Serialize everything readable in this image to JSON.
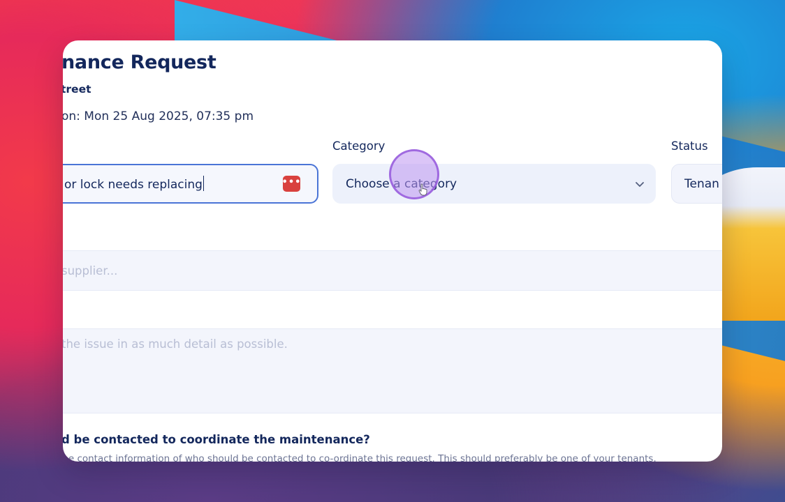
{
  "form": {
    "title": "nance Request",
    "subtitle": "treet",
    "meta": "on: Mon 25 Aug 2025, 07:35 pm"
  },
  "fields": {
    "title_value": "or lock needs replacing",
    "category_label": "Category",
    "category_placeholder": "Choose a category",
    "status_label": "Status",
    "status_value": "Tenan",
    "supplier_placeholder": "supplier...",
    "description_placeholder": "the issue in as much detail as possible."
  },
  "contact": {
    "question": "d be contacted to coordinate the maintenance?",
    "help": "the contact information of who should be contacted to co-ordinate this request. This should preferably be one of your tenants."
  },
  "icons": {
    "password_manager": "password-manager-icon",
    "chevron": "chevron-down-icon",
    "pointer": "hand-pointer-icon"
  },
  "colors": {
    "accent": "#4a74d6",
    "heading": "#13275c",
    "password_icon": "#d9413e",
    "cursor_highlight": "#9b5ee0"
  }
}
